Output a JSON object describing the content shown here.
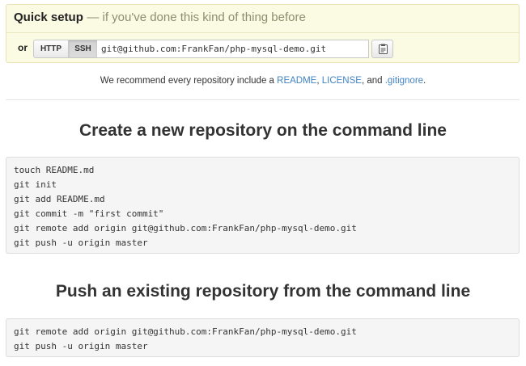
{
  "quick_setup": {
    "title": "Quick setup",
    "subtitle": "— if you've done this kind of thing before",
    "or_label": "or",
    "protocols": {
      "http_label": "HTTP",
      "ssh_label": "SSH",
      "selected": "SSH"
    },
    "clone_url": "git@github.com:FrankFan/php-mysql-demo.git",
    "copy_icon": "clipboard-icon"
  },
  "recommend": {
    "prefix": "We recommend every repository include a ",
    "readme": "README",
    "sep1": ", ",
    "license": "LICENSE",
    "sep2": ", and ",
    "gitignore": ".gitignore",
    "suffix": "."
  },
  "create_section": {
    "title": "Create a new repository on the command line",
    "commands": [
      "touch README.md",
      "git init",
      "git add README.md",
      "git commit -m \"first commit\"",
      "git remote add origin git@github.com:FrankFan/php-mysql-demo.git",
      "git push -u origin master"
    ]
  },
  "push_section": {
    "title": "Push an existing repository from the command line",
    "commands": [
      "git remote add origin git@github.com:FrankFan/php-mysql-demo.git",
      "git push -u origin master"
    ]
  },
  "colors": {
    "link": "#4183c4",
    "setup_background": "#fbfbe3",
    "code_background": "#f5f5f5"
  }
}
